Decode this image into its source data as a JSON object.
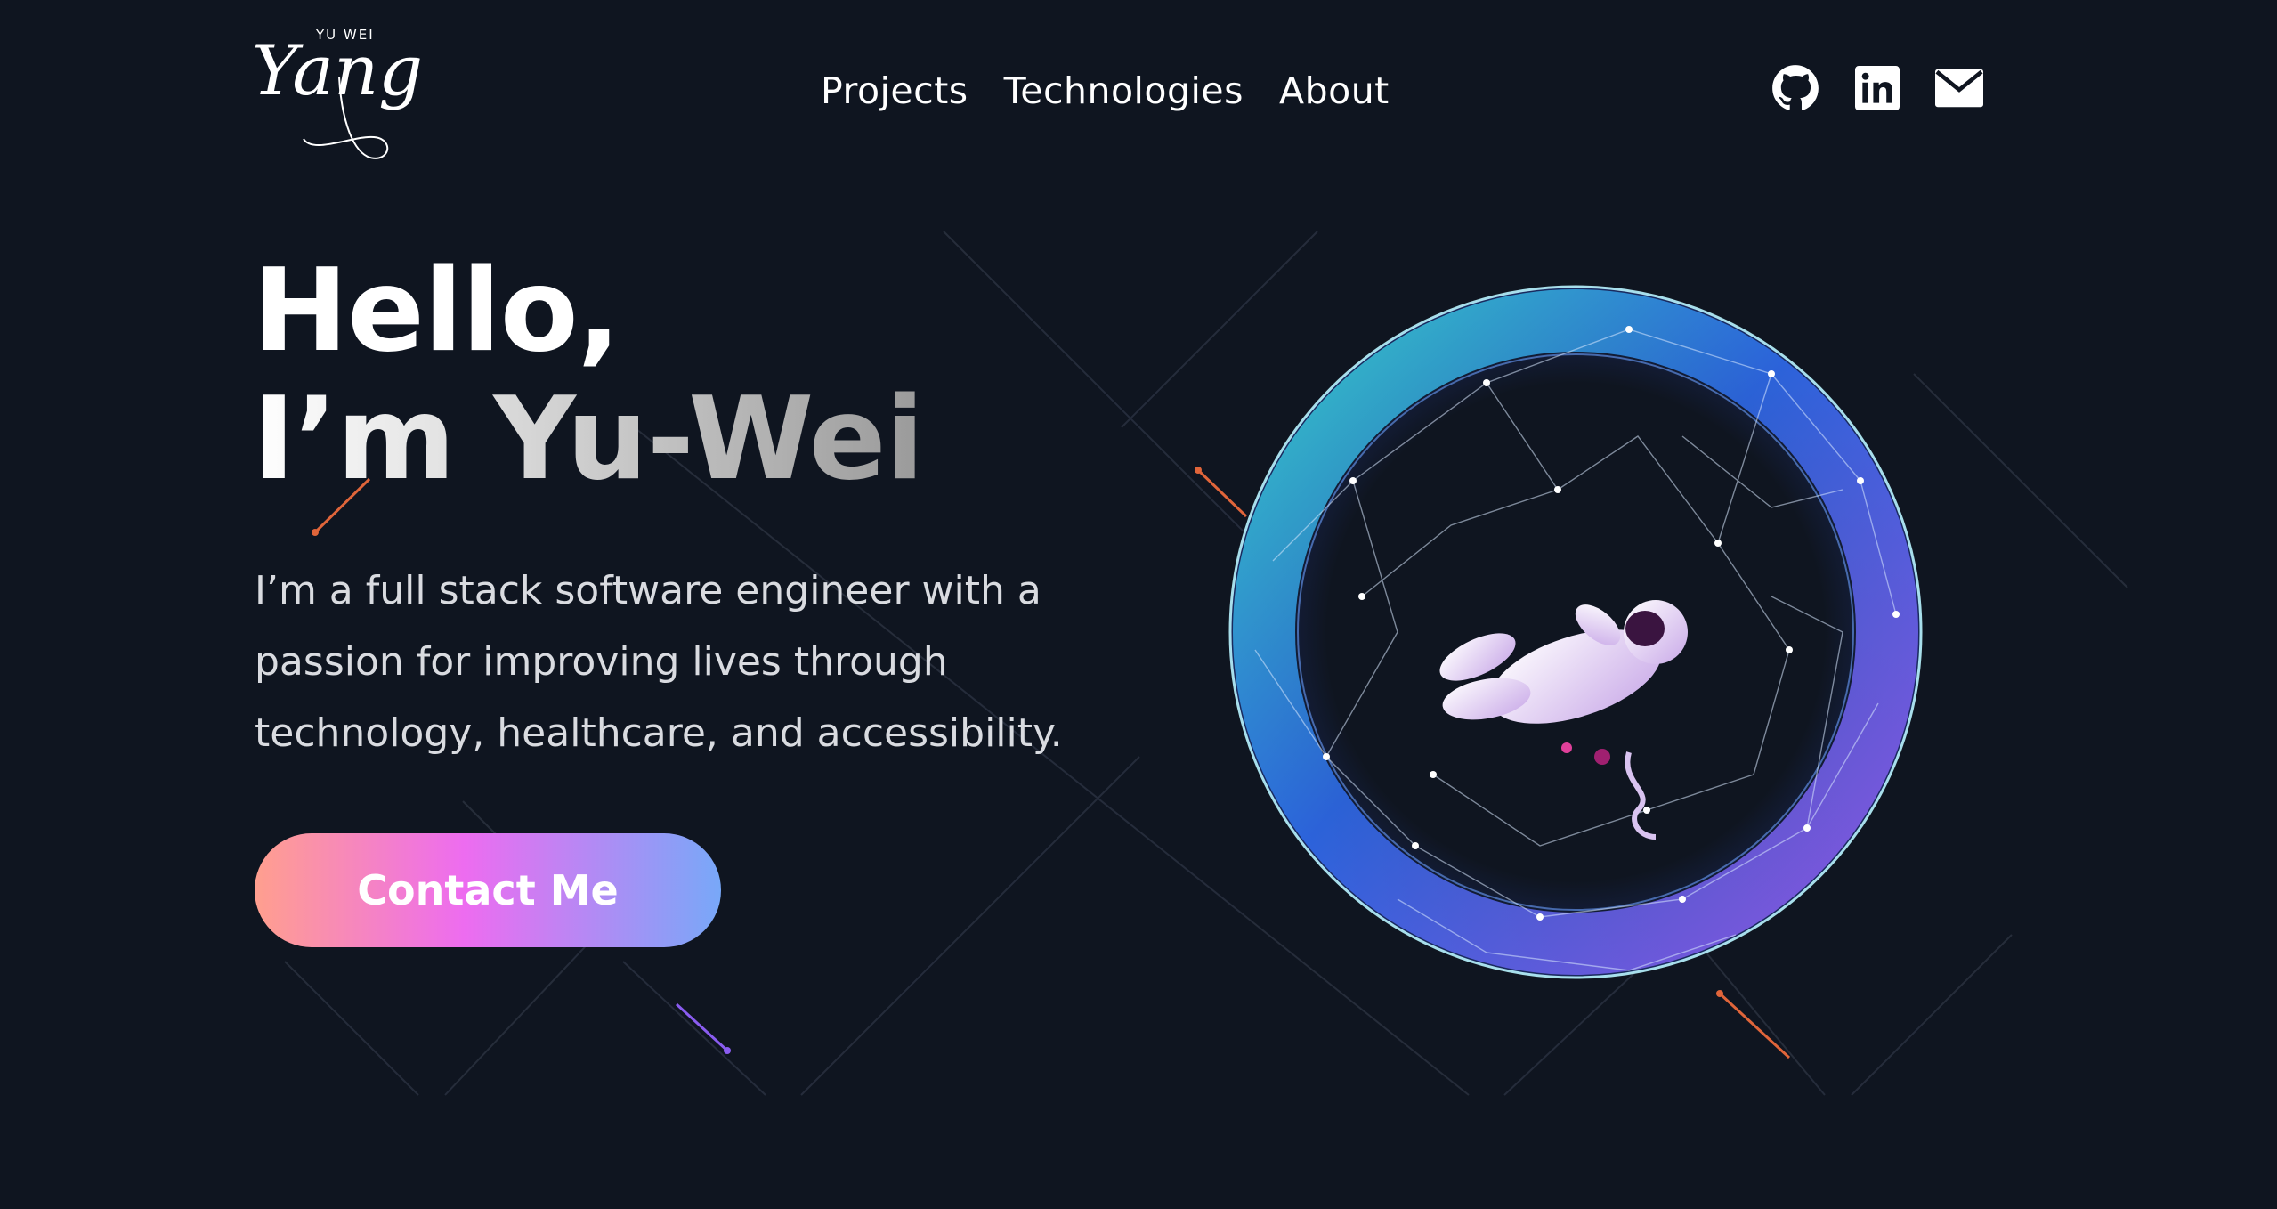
{
  "logo": {
    "small_text": "YU WEI",
    "script_text": "Yang"
  },
  "nav": {
    "items": [
      {
        "label": "Projects"
      },
      {
        "label": "Technologies"
      },
      {
        "label": "About"
      }
    ]
  },
  "socials": [
    {
      "icon": "github-icon"
    },
    {
      "icon": "linkedin-icon"
    },
    {
      "icon": "mail-icon"
    }
  ],
  "hero": {
    "title_line1": "Hello,",
    "title_line2": "I’m Yu-Wei",
    "subtitle": "I’m a full stack software engineer with a passion for improving lives through technology, healthcare, and accessibility.",
    "cta_label": "Contact Me"
  },
  "colors": {
    "background": "#0f1520",
    "cta_gradient_start": "#ff9f8e",
    "cta_gradient_mid": "#ed6cf0",
    "cta_gradient_end": "#78a8f8",
    "globe_cyan": "#39e0d4",
    "globe_blue": "#2f6df0",
    "globe_purple": "#9b5cf0",
    "meteor_orange": "#e0653a"
  }
}
